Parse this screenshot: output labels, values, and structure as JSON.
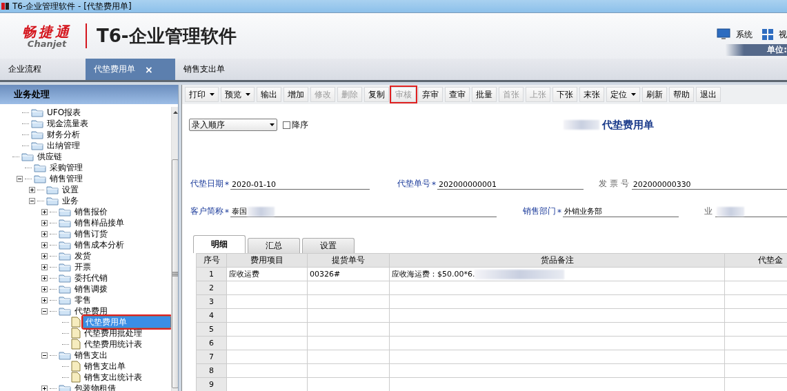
{
  "window": {
    "title": "T6-企业管理软件 - [代垫费用单]"
  },
  "header": {
    "brand": "畅捷通",
    "brand_latin": "Chanjet",
    "product": "T6-企业管理软件",
    "menus": [
      {
        "label": "系统"
      },
      {
        "label": "视"
      }
    ],
    "unit_label": "单位:"
  },
  "tabs": [
    {
      "label": "企业流程",
      "selected": false
    },
    {
      "label": "代垫费用单",
      "selected": true,
      "close": "×"
    },
    {
      "label": "销售支出单",
      "selected": false
    }
  ],
  "sidebar": {
    "title": "业务处理",
    "tree": [
      {
        "children": [
          {
            "label": "UFO报表",
            "kind": "folder"
          },
          {
            "label": "现金流量表",
            "kind": "folder"
          },
          {
            "label": "财务分析",
            "kind": "folder"
          },
          {
            "label": "出纳管理",
            "kind": "folder"
          }
        ]
      },
      {
        "label": "供应链",
        "kind": "folder",
        "children": [
          {
            "label": "采购管理",
            "kind": "folder"
          },
          {
            "label": "销售管理",
            "kind": "folder",
            "expanded": true,
            "children": [
              {
                "label": "设置",
                "kind": "folder",
                "expanded": false
              },
              {
                "label": "业务",
                "kind": "folder",
                "expanded": true,
                "children": [
                  {
                    "label": "销售报价",
                    "kind": "folder",
                    "expanded": false
                  },
                  {
                    "label": "销售样品接单",
                    "kind": "folder",
                    "expanded": false
                  },
                  {
                    "label": "销售订货",
                    "kind": "folder",
                    "expanded": false
                  },
                  {
                    "label": "销售成本分析",
                    "kind": "folder",
                    "expanded": false
                  },
                  {
                    "label": "发货",
                    "kind": "folder",
                    "expanded": false
                  },
                  {
                    "label": "开票",
                    "kind": "folder",
                    "expanded": false
                  },
                  {
                    "label": "委托代销",
                    "kind": "folder",
                    "expanded": false
                  },
                  {
                    "label": "销售调拨",
                    "kind": "folder",
                    "expanded": false
                  },
                  {
                    "label": "零售",
                    "kind": "folder",
                    "expanded": false
                  },
                  {
                    "label": "代垫费用",
                    "kind": "folder",
                    "expanded": true,
                    "children": [
                      {
                        "label": "代垫费用单",
                        "kind": "document",
                        "selected": true
                      },
                      {
                        "label": "代垫费用批处理",
                        "kind": "document",
                        "selected": false
                      },
                      {
                        "label": "代垫费用统计表",
                        "kind": "document",
                        "selected": false
                      }
                    ]
                  },
                  {
                    "label": "销售支出",
                    "kind": "folder",
                    "expanded": true,
                    "children": [
                      {
                        "label": "销售支出单",
                        "kind": "document",
                        "selected": false
                      },
                      {
                        "label": "销售支出统计表",
                        "kind": "document",
                        "selected": false
                      }
                    ]
                  },
                  {
                    "label": "包装物租借",
                    "kind": "folder",
                    "expanded": false
                  }
                ]
              }
            ]
          }
        ]
      }
    ]
  },
  "toolbar": [
    {
      "label": "打印",
      "dropdown": true,
      "disabled": false,
      "highlighted": false
    },
    {
      "label": "预览",
      "dropdown": true,
      "disabled": false,
      "highlighted": false
    },
    {
      "label": "输出",
      "dropdown": false,
      "disabled": false,
      "highlighted": false
    },
    {
      "label": "增加",
      "dropdown": false,
      "disabled": false,
      "highlighted": false
    },
    {
      "label": "修改",
      "dropdown": false,
      "disabled": true,
      "highlighted": false
    },
    {
      "label": "删除",
      "dropdown": false,
      "disabled": true,
      "highlighted": false
    },
    {
      "label": "复制",
      "dropdown": false,
      "disabled": false,
      "highlighted": false
    },
    {
      "label": "审核",
      "dropdown": false,
      "disabled": true,
      "highlighted": true
    },
    {
      "label": "弃审",
      "dropdown": false,
      "disabled": false,
      "highlighted": false
    },
    {
      "label": "查审",
      "dropdown": false,
      "disabled": false,
      "highlighted": false
    },
    {
      "label": "批量",
      "dropdown": false,
      "disabled": false,
      "highlighted": false
    },
    {
      "label": "首张",
      "dropdown": false,
      "disabled": true,
      "highlighted": false
    },
    {
      "label": "上张",
      "dropdown": false,
      "disabled": true,
      "highlighted": false
    },
    {
      "label": "下张",
      "dropdown": false,
      "disabled": false,
      "highlighted": false
    },
    {
      "label": "末张",
      "dropdown": false,
      "disabled": false,
      "highlighted": false
    },
    {
      "label": "定位",
      "dropdown": true,
      "disabled": false,
      "highlighted": false
    },
    {
      "label": "刷新",
      "dropdown": false,
      "disabled": false,
      "highlighted": false
    },
    {
      "label": "帮助",
      "dropdown": false,
      "disabled": false,
      "highlighted": false
    },
    {
      "label": "退出",
      "dropdown": false,
      "disabled": false,
      "highlighted": false
    }
  ],
  "form": {
    "sort_select": "录入顺序",
    "descending": {
      "label": "降序",
      "checked": false
    },
    "title": "代垫费用单",
    "fields": [
      [
        {
          "label": "代垫日期",
          "required_mark": "*",
          "value": "2020-01-10"
        },
        {
          "label": "代垫单号",
          "required_mark": "*",
          "value": "202000000001"
        },
        {
          "label": "发 票 号",
          "value": "202000000330"
        }
      ],
      [
        {
          "label": "客户简称",
          "required_mark": "*",
          "value": "泰国"
        },
        {
          "label": "销售部门",
          "required_mark": "*",
          "value": "外销业务部"
        },
        {
          "label": "业"
        }
      ]
    ],
    "detail_tabs": [
      {
        "label": "明细",
        "selected": true
      },
      {
        "label": "汇总",
        "selected": false
      },
      {
        "label": "设置",
        "selected": false
      }
    ],
    "table": {
      "columns": [
        "序号",
        "费用项目",
        "提货单号",
        "货品备注",
        "代垫金"
      ],
      "rows": [
        [
          "1",
          "应收运费",
          "00326#",
          "应收海运费：$50.00*6.",
          ""
        ],
        [
          "2",
          "",
          "",
          "",
          ""
        ],
        [
          "3",
          "",
          "",
          "",
          ""
        ],
        [
          "4",
          "",
          "",
          "",
          ""
        ],
        [
          "5",
          "",
          "",
          "",
          ""
        ],
        [
          "6",
          "",
          "",
          "",
          ""
        ],
        [
          "7",
          "",
          "",
          "",
          ""
        ],
        [
          "8",
          "",
          "",
          "",
          ""
        ],
        [
          "9",
          "",
          "",
          "",
          ""
        ]
      ]
    }
  }
}
